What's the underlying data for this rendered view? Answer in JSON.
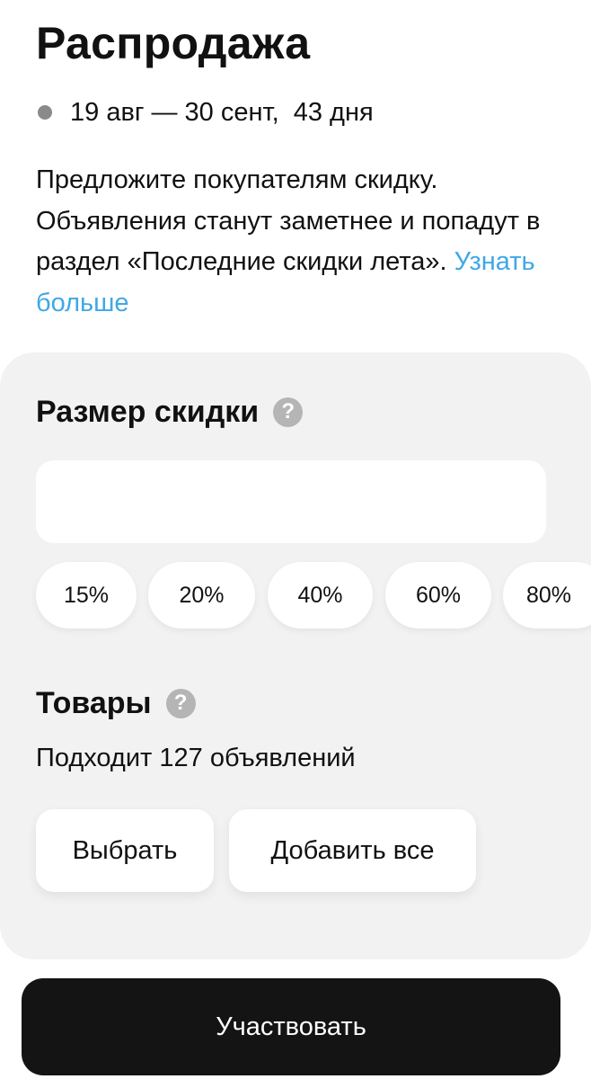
{
  "header": {
    "title": "Распродажа",
    "dates": "19 авг — 30 сент,  43 дня"
  },
  "description": {
    "text": "Предложите покупателям скидку. Объявления станут заметнее и попадут в раздел «Последние скидки лета». ",
    "link": "Узнать больше"
  },
  "discount": {
    "heading": "Размер скидки",
    "help_icon": "?",
    "input_value": "",
    "options": [
      "15%",
      "20%",
      "40%",
      "60%",
      "80%"
    ]
  },
  "products": {
    "heading": "Товары",
    "help_icon": "?",
    "eligible_text": "Подходит 127 объявлений",
    "select_label": "Выбрать",
    "add_all_label": "Добавить все"
  },
  "footer": {
    "participate_label": "Участвовать"
  },
  "colors": {
    "link": "#3fa8e6",
    "primary_button": "#141414",
    "card_background": "#f2f2f2",
    "status_dot": "#8a8a8a"
  }
}
